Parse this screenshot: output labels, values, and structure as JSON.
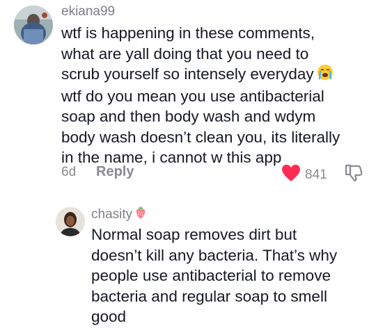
{
  "comment": {
    "username": "ekiana99",
    "text_lines": [
      "wtf is happening in these comments,",
      "what are yall doing that you need to",
      "scrub yourself so intensely everyday",
      "wtf do you mean you use antibacterial",
      "soap and then body wash and wdym",
      "body wash doesn’t clean you, its literally",
      "in the name, i cannot w this app"
    ],
    "emoji": "crying-face-emoji",
    "age": "6d",
    "reply_label": "Reply",
    "like_count": "841",
    "liked": true,
    "accent": "#fe2c55"
  },
  "reply": {
    "username": "chasity",
    "username_emoji": "strawberry-emoji",
    "text_lines": [
      "Normal soap removes dirt but",
      "doesn’t kill any bacteria. That’s why",
      "people use antibacterial to remove",
      "bacteria and regular soap to smell",
      "good"
    ]
  }
}
